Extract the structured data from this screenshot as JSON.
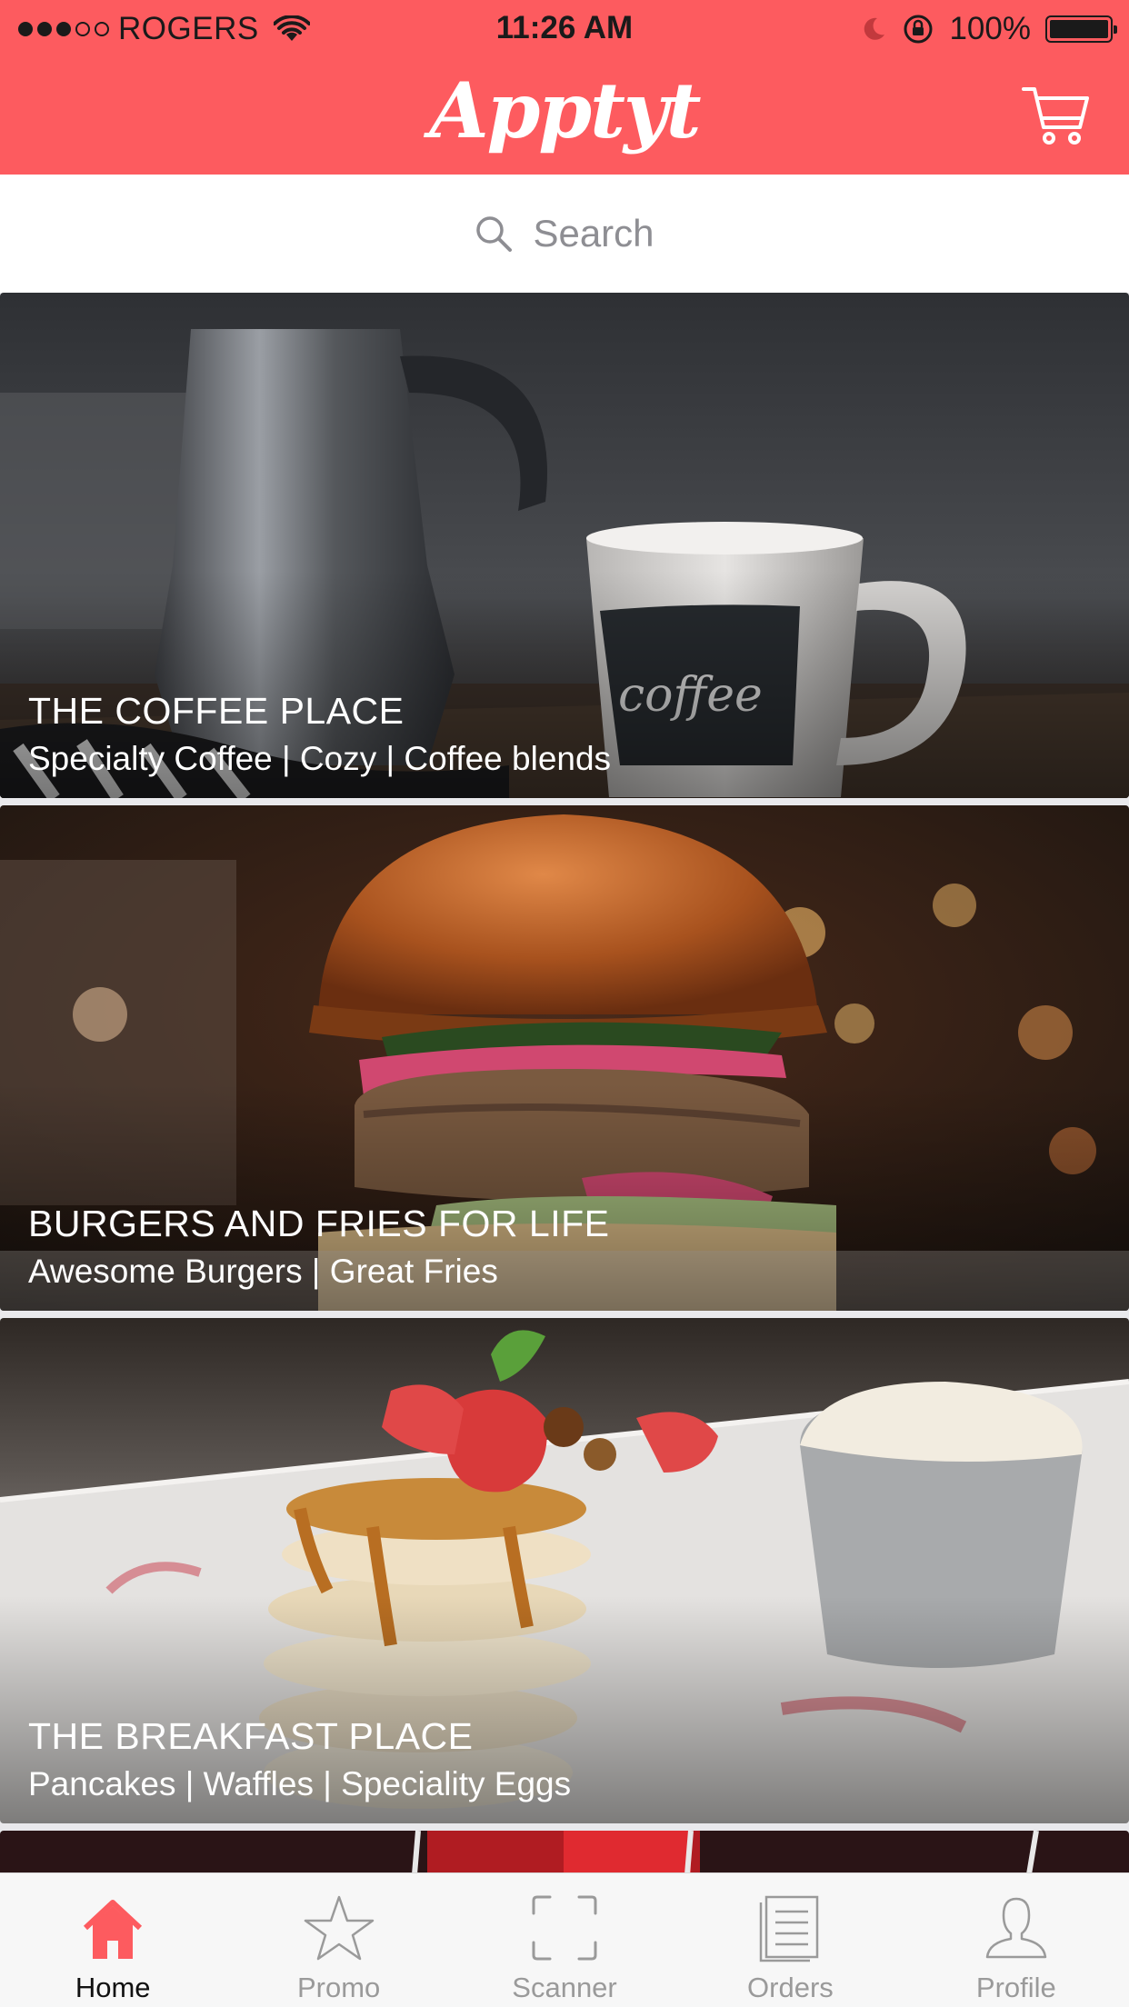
{
  "status_bar": {
    "carrier": "ROGERS",
    "time": "11:26 AM",
    "battery": "100%",
    "signal_bars_filled": 3,
    "signal_bars_total": 5
  },
  "nav": {
    "brand": "Apptyt",
    "cart_icon": "cart-icon"
  },
  "search": {
    "placeholder": "Search",
    "icon": "search-icon"
  },
  "feed": [
    {
      "title": "THE COFFEE PLACE",
      "tags": "Specialty Coffee | Cozy | Coffee blends",
      "image": "coffee-photo"
    },
    {
      "title": "BURGERS AND FRIES FOR LIFE",
      "tags": "Awesome Burgers | Great Fries",
      "image": "burger-photo"
    },
    {
      "title": "THE BREAKFAST PLACE",
      "tags": "Pancakes | Waffles | Speciality Eggs",
      "image": "pancakes-photo"
    }
  ],
  "tabs": [
    {
      "label": "Home",
      "icon": "home-icon",
      "active": true
    },
    {
      "label": "Promo",
      "icon": "star-icon",
      "active": false
    },
    {
      "label": "Scanner",
      "icon": "scanner-icon",
      "active": false
    },
    {
      "label": "Orders",
      "icon": "orders-icon",
      "active": false
    },
    {
      "label": "Profile",
      "icon": "profile-icon",
      "active": false
    }
  ],
  "colors": {
    "brand": "#fd5b5f",
    "tab_active": "#fd5b5f",
    "tab_inactive": "#9a9a9a"
  }
}
